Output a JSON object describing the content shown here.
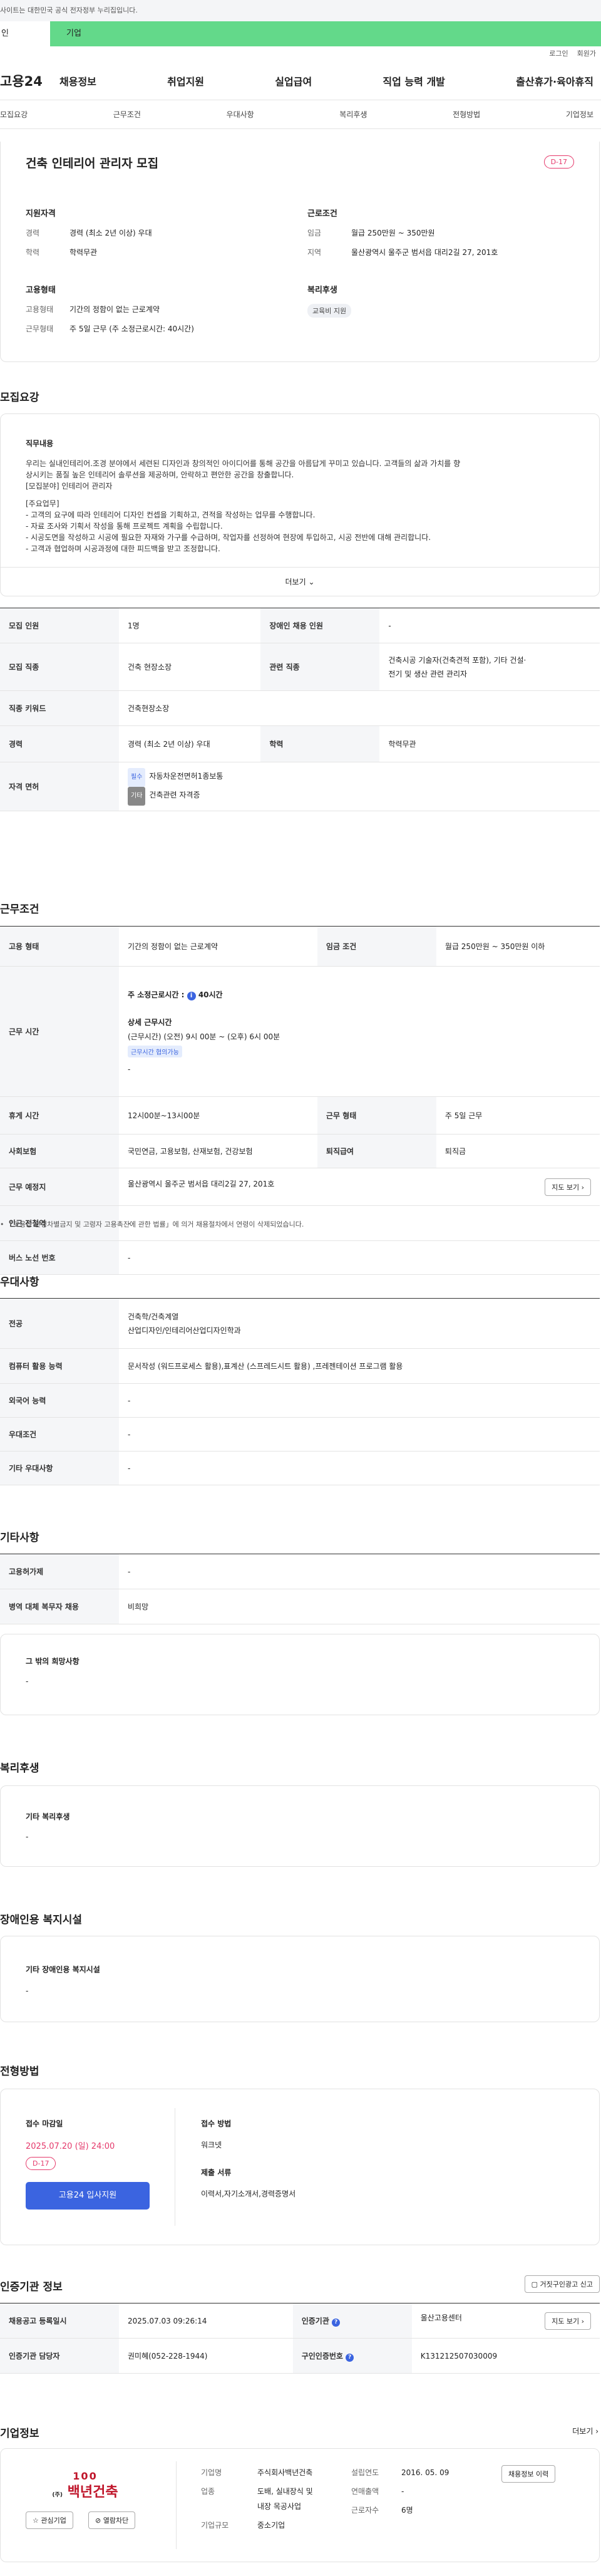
{
  "top_notice": "사이트는 대한민국 공식 전자정부 누리집입니다.",
  "segments": {
    "personal": "인",
    "corporate": "기업"
  },
  "util": [
    "로그인",
    "회원가"
  ],
  "logo": "고용24",
  "gnb": [
    "채용정보",
    "취업지원",
    "실업급여",
    "직업 능력 개발",
    "출산휴가·육아휴직"
  ],
  "tabs": [
    "모집요강",
    "근무조건",
    "우대사항",
    "복리후생",
    "전형방법",
    "기업정보"
  ],
  "header": {
    "title": "건축 인테리어 관리자 모집",
    "dday": "D-17",
    "qual_title": "지원자격",
    "qual": [
      {
        "k": "경력",
        "v": "경력 (최소 2년 이상) 우대"
      },
      {
        "k": "학력",
        "v": "학력무관"
      }
    ],
    "cond_title": "근로조건",
    "cond": [
      {
        "k": "임금",
        "v": "월급 250만원 ~ 350만원"
      },
      {
        "k": "지역",
        "v": "울산광역시 울주군 범서읍 대리2길 27, 201호"
      }
    ],
    "emp_title": "고용형태",
    "emp": [
      {
        "k": "고용형태",
        "v": "기간의 정함이 없는 근로계약"
      },
      {
        "k": "근무형태",
        "v": "주 5일 근무 (주 소정근로시간: 40시간)"
      }
    ],
    "welfare_title": "복리후생",
    "welfare_badge": "교육비 지원"
  },
  "recruit": {
    "title": "모집요강",
    "duty_title": "직무내용",
    "duty_lines": [
      "우리는 실내인테리어.조경 분야에서 세련된 디자인과 창의적인 아이디어를 통해 공간을 아름답게 꾸미고 있습니다. 고객들의 삶과 가치를 향",
      "상시키는 품질 높은 인테리어 솔루션을 제공하며, 안락하고 편안한 공간을 창출합니다.",
      "[모집분야] 인테리어 관리자",
      "",
      "[주요업무]",
      "- 고객의 요구에 따라 인테리어 디자인 컨셉을 기획하고, 견적을 작성하는 업무를 수행합니다.",
      "- 자료 조사와 기획서 작성을 통해 프로젝트 계획을 수립합니다.",
      "- 시공도면을 작성하고 시공에 필요한 자재와 가구를 수급하며, 작업자를 선정하여 현장에 투입하고, 시공 전반에 대해 관리합니다.",
      "- 고객과 협업하며 시공과정에 대한 피드백을 받고 조정합니다."
    ],
    "more": "더보기",
    "rows": {
      "count_k": "모집 인원",
      "count_v": "1명",
      "disabled_k": "장애인 채용 인원",
      "disabled_v": "-",
      "job_k": "모집 직종",
      "job_v": "건축 현장소장",
      "related_k": "관련 직종",
      "related_v1": "건축시공 기술자(건축견적 포함), 기타 건설·",
      "related_v2": "전기 및 생산 관련 관리자",
      "kw_k": "직종 키워드",
      "kw_v": "건축현장소장",
      "career_k": "경력",
      "career_v": "경력 (최소 2년 이상) 우대",
      "edu_k": "학력",
      "edu_v": "학력무관",
      "license_k": "자격 면허",
      "lic1_tag": "필수",
      "lic1": "자동차운전면허1종보통",
      "lic2_tag": "기타",
      "lic2": "건축관련 자격증"
    }
  },
  "work": {
    "title": "근무조건",
    "type_k": "고용 형태",
    "type_v": "기간의 정함이 없는 근로계약",
    "wage_k": "임금 조건",
    "wage_v": "월급 250만원 ~ 350만원 이하",
    "hours_k": "근무 시간",
    "hours_label": "주 소정근로시간 :",
    "hours_val": "40시간",
    "hours_detail_title": "상세 근무시간",
    "hours_detail": "(근무시간) (오전) 9시 00분 ~ (오후) 6시 00분",
    "hours_tag": "근무시간 협의가능",
    "hours_dash": "-",
    "break_k": "휴게 시간",
    "break_v": "12시00분~13시00분",
    "form_k": "근무 형태",
    "form_v": "주 5일 근무",
    "ins_k": "사회보험",
    "ins_v": "국민연금, 고용보험, 산재보험, 건강보험",
    "ret_k": "퇴직급여",
    "ret_v": "퇴직금",
    "place_k": "근무 예정지",
    "place_v": "울산광역시 울주군 범서읍 대리2길 27, 201호",
    "map_btn": "지도 보기",
    "station_k": "인근 전철역",
    "station_v": "-",
    "bus_k": "버스 노선 번호",
    "bus_v": "-",
    "note": "「고용상 연령차별금지 및 고령자 고용촉진에 관한 법률」에 의거 채용절차에서 연령이 삭제되었습니다."
  },
  "pref": {
    "title": "우대사항",
    "major_k": "전공",
    "major_v1": "건축학/건축계열",
    "major_v2": "산업디자인/인테리어산업디자인학과",
    "pc_k": "컴퓨터 활용 능력",
    "pc_v": "문서작성 (워드프로세스 활용),표계산 (스프레드시트 활용) ,프레젠테이션 프로그램 활용",
    "lang_k": "외국어 능력",
    "lang_v": "-",
    "cond_k": "우대조건",
    "cond_v": "-",
    "etc_k": "기타 우대사항",
    "etc_v": "-"
  },
  "etc": {
    "title": "기타사항",
    "ins_k": "고용허가제",
    "ins_v": "-",
    "mil_k": "병역 대체 복무자 채용",
    "mil_v": "비희망",
    "other_title": "그 밖의 희망사항",
    "other_v": "-"
  },
  "benefit": {
    "title": "복리후생",
    "box_title": "기타 복리후생",
    "box_v": "-"
  },
  "disab": {
    "title": "장애인용 복지시설",
    "box_title": "기타 장애인용 복지시설",
    "box_v": "-"
  },
  "apply": {
    "title": "전형방법",
    "deadline_k": "접수 마감일",
    "deadline_v": "2025.07.20 (일) 24:00",
    "dday": "D-17",
    "apply_btn": "고용24 입사지원",
    "method_k": "접수 방법",
    "method_v": "워크넷",
    "docs_k": "제출 서류",
    "docs_v": "이력서,자기소개서,경력증명서"
  },
  "agency": {
    "title": "인증기관 정보",
    "report_btn": "거짓구인광고 신고",
    "reg_k": "채용공고 등록일시",
    "reg_v": "2025.07.03 09:26:14",
    "org_k": "인증기관",
    "org_v": "울산고용센터",
    "map_btn": "지도 보기",
    "mgr_k": "인증기관 담당자",
    "mgr_v": "권미혜(052-228-1944)",
    "num_k": "구인인증번호",
    "num_v": "K131212507030009"
  },
  "company": {
    "title": "기업정보",
    "more": "더보기",
    "logo_top": "100",
    "logo_main": "백년건축",
    "logo_sub": "(주)",
    "fav_btn": "관심기업",
    "block_btn": "열람차단",
    "name_k": "기업명",
    "name_v": "주식회사백년건축",
    "ind_k": "업종",
    "ind_v1": "도배, 실내장식 및",
    "ind_v2": "내장 목공사업",
    "size_k": "기업규모",
    "size_v": "중소기업",
    "est_k": "설립연도",
    "est_v": "2016. 05. 09",
    "sales_k": "연매출액",
    "sales_v": "-",
    "emp_k": "근로자수",
    "emp_v": "6명",
    "jobs_btn": "채용정보 이력"
  }
}
